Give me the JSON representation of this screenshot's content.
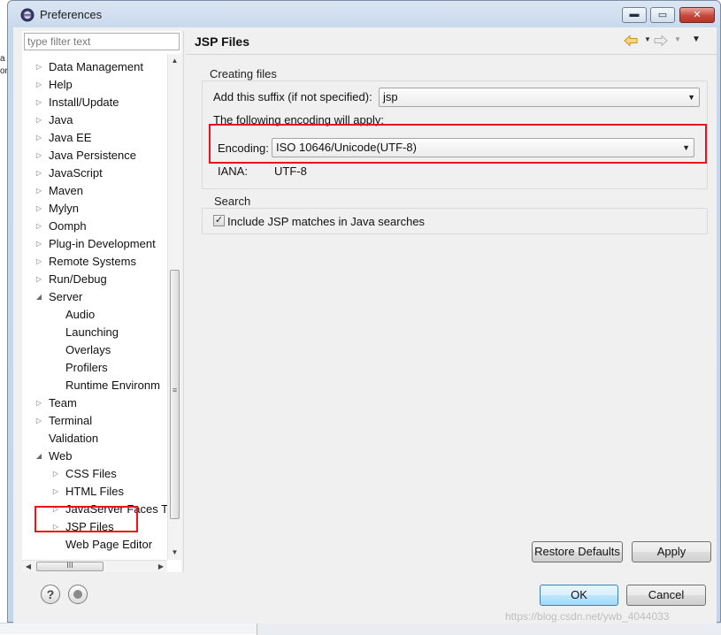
{
  "outside": {
    "left_fragments": [
      "a",
      "or:"
    ]
  },
  "window": {
    "title": "Preferences",
    "min_glyph": "▬",
    "max_glyph": "▭",
    "close_glyph": "✕"
  },
  "filter": {
    "placeholder": "type filter text",
    "value": ""
  },
  "tree": {
    "items": [
      {
        "label": "Data Management",
        "level": 0,
        "twisty": "collapsed"
      },
      {
        "label": "Help",
        "level": 0,
        "twisty": "collapsed"
      },
      {
        "label": "Install/Update",
        "level": 0,
        "twisty": "collapsed"
      },
      {
        "label": "Java",
        "level": 0,
        "twisty": "collapsed"
      },
      {
        "label": "Java EE",
        "level": 0,
        "twisty": "collapsed"
      },
      {
        "label": "Java Persistence",
        "level": 0,
        "twisty": "collapsed"
      },
      {
        "label": "JavaScript",
        "level": 0,
        "twisty": "collapsed"
      },
      {
        "label": "Maven",
        "level": 0,
        "twisty": "collapsed"
      },
      {
        "label": "Mylyn",
        "level": 0,
        "twisty": "collapsed"
      },
      {
        "label": "Oomph",
        "level": 0,
        "twisty": "collapsed"
      },
      {
        "label": "Plug-in Development",
        "level": 0,
        "twisty": "collapsed"
      },
      {
        "label": "Remote Systems",
        "level": 0,
        "twisty": "collapsed"
      },
      {
        "label": "Run/Debug",
        "level": 0,
        "twisty": "collapsed"
      },
      {
        "label": "Server",
        "level": 0,
        "twisty": "expanded"
      },
      {
        "label": "Audio",
        "level": 1,
        "twisty": "none"
      },
      {
        "label": "Launching",
        "level": 1,
        "twisty": "none"
      },
      {
        "label": "Overlays",
        "level": 1,
        "twisty": "none"
      },
      {
        "label": "Profilers",
        "level": 1,
        "twisty": "none"
      },
      {
        "label": "Runtime Environm",
        "level": 1,
        "twisty": "none"
      },
      {
        "label": "Team",
        "level": 0,
        "twisty": "collapsed"
      },
      {
        "label": "Terminal",
        "level": 0,
        "twisty": "collapsed"
      },
      {
        "label": "Validation",
        "level": 0,
        "twisty": "none"
      },
      {
        "label": "Web",
        "level": 0,
        "twisty": "expanded"
      },
      {
        "label": "CSS Files",
        "level": 1,
        "twisty": "collapsed"
      },
      {
        "label": "HTML Files",
        "level": 1,
        "twisty": "collapsed"
      },
      {
        "label": "JavaServer Faces T",
        "level": 1,
        "twisty": "collapsed"
      },
      {
        "label": "JSP Files",
        "level": 1,
        "twisty": "collapsed",
        "selected": true
      },
      {
        "label": "Web Page Editor",
        "level": 1,
        "twisty": "none"
      }
    ]
  },
  "scroll": {
    "grip": "≡",
    "h_grip": "III"
  },
  "page": {
    "title": "JSP Files",
    "creating_group": "Creating files",
    "suffix_label": "Add this suffix (if not specified):",
    "suffix_value": "jsp",
    "encoding_note": "The following encoding will apply:",
    "encoding_label": "Encoding:",
    "encoding_value": "ISO 10646/Unicode(UTF-8)",
    "iana_label": "IANA:",
    "iana_value": "UTF-8",
    "search_group": "Search",
    "include_label": "Include JSP matches in Java searches",
    "include_checked": true
  },
  "buttons": {
    "restore_defaults": "Restore Defaults",
    "apply": "Apply",
    "ok": "OK",
    "cancel": "Cancel",
    "help": "?"
  },
  "watermark": "https://blog.csdn.net/ywb_4044033",
  "colors": {
    "highlight": "#e8141c",
    "nav_back": "#e8a21c",
    "accent_ok": "#3c7fb1"
  }
}
